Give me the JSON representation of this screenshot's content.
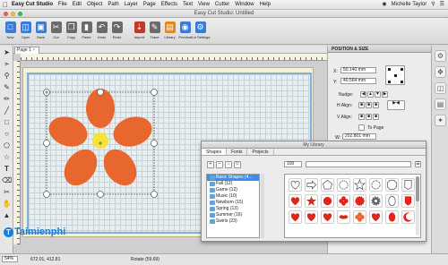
{
  "menubar": {
    "app": "Easy Cut Studio",
    "items": [
      "File",
      "Edit",
      "Object",
      "Path",
      "Layer",
      "Page",
      "Effects",
      "Text",
      "View",
      "Cutter",
      "Window",
      "Help"
    ],
    "user": "Michelle Taylor"
  },
  "window": {
    "title": "Easy Cut Studio: Untitled"
  },
  "toolbar": {
    "buttons": [
      {
        "label": "New",
        "icon": "new-doc-icon",
        "color": "#3a7bd5"
      },
      {
        "label": "Open",
        "icon": "open-folder-icon",
        "color": "#3a7bd5"
      },
      {
        "label": "Save",
        "icon": "save-icon",
        "color": "#3a7bd5"
      },
      {
        "label": "Cut",
        "icon": "scissors-icon",
        "color": "#6b6b6b"
      },
      {
        "label": "Copy",
        "icon": "copy-icon",
        "color": "#6b6b6b"
      },
      {
        "label": "Paste",
        "icon": "paste-icon",
        "color": "#6b6b6b"
      },
      {
        "label": "Undo",
        "icon": "undo-icon",
        "color": "#6b6b6b"
      },
      {
        "label": "Redo",
        "icon": "redo-icon",
        "color": "#6b6b6b"
      },
      {
        "label": "Import",
        "icon": "import-icon",
        "color": "#c0392b"
      },
      {
        "label": "Trace",
        "icon": "trace-icon",
        "color": "#6b6b6b"
      },
      {
        "label": "Library",
        "icon": "library-icon",
        "color": "#e08a1e"
      },
      {
        "label": "Preview",
        "icon": "preview-icon",
        "color": "#3a7bd5"
      },
      {
        "label": "Cut Settings",
        "icon": "cut-settings-icon",
        "color": "#3a7bd5"
      }
    ]
  },
  "document": {
    "tab": "Page 1"
  },
  "canvas": {
    "flower_color": "#e8672e",
    "center_color": "#f3e33a"
  },
  "position_size": {
    "title": "POSITION & SIZE",
    "x_label": "X:",
    "x_value": "50.140 mm",
    "y_label": "Y:",
    "y_value": "40.564 mm",
    "nudge_label": "Nudge:",
    "halign_label": "H Align:",
    "valign_label": "V Align:",
    "topage_label": "To Page",
    "w_label": "W:",
    "w_value": "202.801 mm"
  },
  "library": {
    "title": "My Library",
    "tabs": [
      "Shapes",
      "Fonts",
      "Projects"
    ],
    "zoom": "100",
    "tree": [
      {
        "label": "Basic Shapes (4...",
        "selected": true
      },
      {
        "label": "Fall (12)",
        "selected": false
      },
      {
        "label": "Game (12)",
        "selected": false
      },
      {
        "label": "Music (10)",
        "selected": false
      },
      {
        "label": "Newborn (15)",
        "selected": false
      },
      {
        "label": "Spring (13)",
        "selected": false
      },
      {
        "label": "Summer (16)",
        "selected": false
      },
      {
        "label": "Swirls (23)",
        "selected": false
      }
    ]
  },
  "status": {
    "zoom": "54%",
    "coords": "672.01, 412.81",
    "rotate": "Rotate (59.69)"
  },
  "watermark": "Taimienphi"
}
